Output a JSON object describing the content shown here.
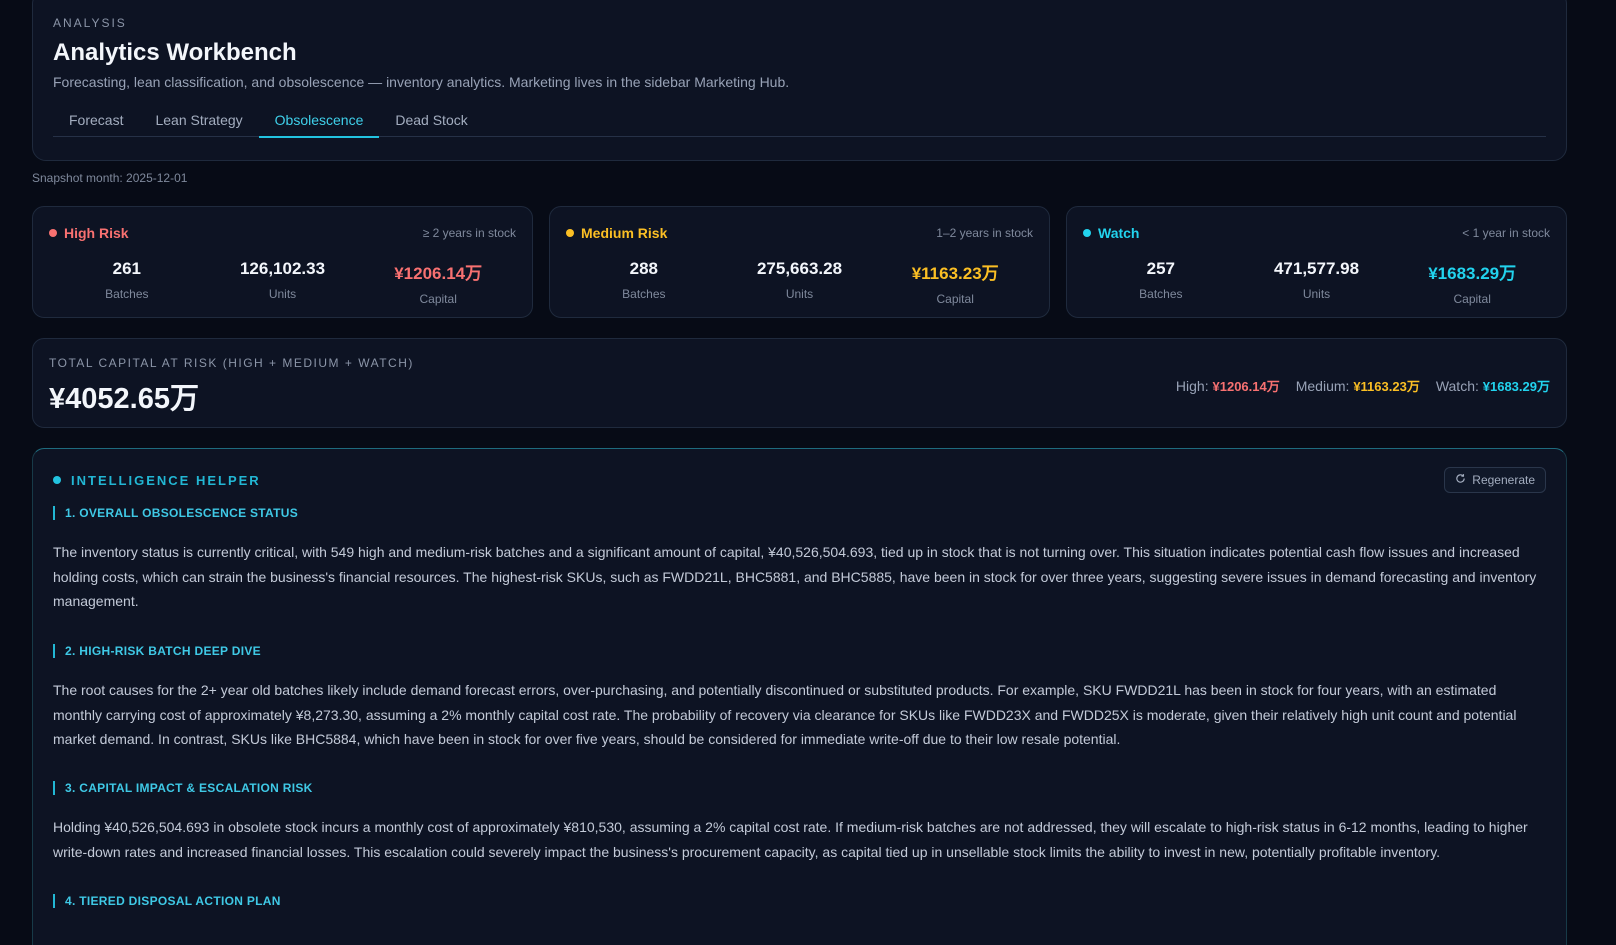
{
  "header": {
    "eyebrow": "ANALYSIS",
    "title": "Analytics Workbench",
    "subtitle": "Forecasting, lean classification, and obsolescence — inventory analytics. Marketing lives in the sidebar Marketing Hub.",
    "tabs": [
      {
        "label": "Forecast",
        "active": false
      },
      {
        "label": "Lean Strategy",
        "active": false
      },
      {
        "label": "Obsolescence",
        "active": true
      },
      {
        "label": "Dead Stock",
        "active": false
      }
    ]
  },
  "snapshot": "Snapshot month: 2025-12-01",
  "risk_cards": [
    {
      "label": "High Risk",
      "note": "≥ 2 years in stock",
      "color": "#f87171",
      "batches": "261",
      "units": "126,102.33",
      "capital": "¥1206.14万",
      "batches_label": "Batches",
      "units_label": "Units",
      "capital_label": "Capital"
    },
    {
      "label": "Medium Risk",
      "note": "1–2 years in stock",
      "color": "#fbbf24",
      "batches": "288",
      "units": "275,663.28",
      "capital": "¥1163.23万",
      "batches_label": "Batches",
      "units_label": "Units",
      "capital_label": "Capital"
    },
    {
      "label": "Watch",
      "note": "< 1 year in stock",
      "color": "#22d3ee",
      "batches": "257",
      "units": "471,577.98",
      "capital": "¥1683.29万",
      "batches_label": "Batches",
      "units_label": "Units",
      "capital_label": "Capital"
    }
  ],
  "total": {
    "label": "TOTAL CAPITAL AT RISK (HIGH + MEDIUM + WATCH)",
    "value": "¥4052.65万",
    "high_label": "High:",
    "high_value": "¥1206.14万",
    "medium_label": "Medium:",
    "medium_value": "¥1163.23万",
    "watch_label": "Watch:",
    "watch_value": "¥1683.29万"
  },
  "intel": {
    "title": "INTELLIGENCE HELPER",
    "regenerate_label": "Regenerate",
    "regenerate_icon": "refresh-icon",
    "sections": [
      {
        "heading": "1. OVERALL OBSOLESCENCE STATUS",
        "body": "The inventory status is currently critical, with 549 high and medium-risk batches and a significant amount of capital, ¥40,526,504.693, tied up in stock that is not turning over. This situation indicates potential cash flow issues and increased holding costs, which can strain the business's financial resources. The highest-risk SKUs, such as FWDD21L, BHC5881, and BHC5885, have been in stock for over three years, suggesting severe issues in demand forecasting and inventory management."
      },
      {
        "heading": "2. HIGH-RISK BATCH DEEP DIVE",
        "body": "The root causes for the 2+ year old batches likely include demand forecast errors, over-purchasing, and potentially discontinued or substituted products. For example, SKU FWDD21L has been in stock for four years, with an estimated monthly carrying cost of approximately ¥8,273.30, assuming a 2% monthly capital cost rate. The probability of recovery via clearance for SKUs like FWDD23X and FWDD25X is moderate, given their relatively high unit count and potential market demand. In contrast, SKUs like BHC5884, which have been in stock for over five years, should be considered for immediate write-off due to their low resale potential."
      },
      {
        "heading": "3. CAPITAL IMPACT & ESCALATION RISK",
        "body": "Holding ¥40,526,504.693 in obsolete stock incurs a monthly cost of approximately ¥810,530, assuming a 2% capital cost rate. If medium-risk batches are not addressed, they will escalate to high-risk status in 6-12 months, leading to higher write-down rates and increased financial losses. This escalation could severely impact the business's procurement capacity, as capital tied up in unsellable stock limits the ability to invest in new, potentially profitable inventory."
      },
      {
        "heading": "4. TIERED DISPOSAL ACTION PLAN",
        "body": ""
      }
    ]
  }
}
